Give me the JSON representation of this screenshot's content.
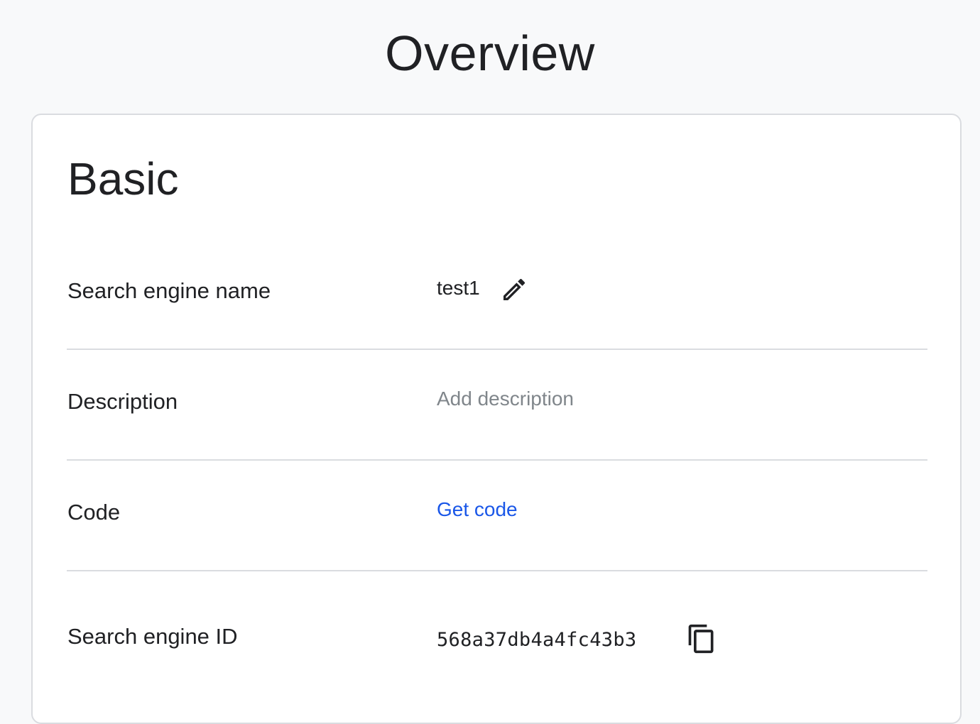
{
  "page": {
    "title": "Overview"
  },
  "basic": {
    "title": "Basic",
    "rows": [
      {
        "label": "Search engine name",
        "value": "test1",
        "icon": "pencil-edit-icon"
      },
      {
        "label": "Description",
        "placeholder": "Add description"
      },
      {
        "label": "Code",
        "link": "Get code"
      },
      {
        "label": "Search engine ID",
        "value": "568a37db4a4fc43b3",
        "icon": "copy-icon"
      }
    ]
  },
  "colors": {
    "background": "#f8f9fa",
    "card": "#ffffff",
    "text": "#202124",
    "placeholder": "#80868b",
    "link": "#1a57e8",
    "divider": "#dadce0"
  }
}
